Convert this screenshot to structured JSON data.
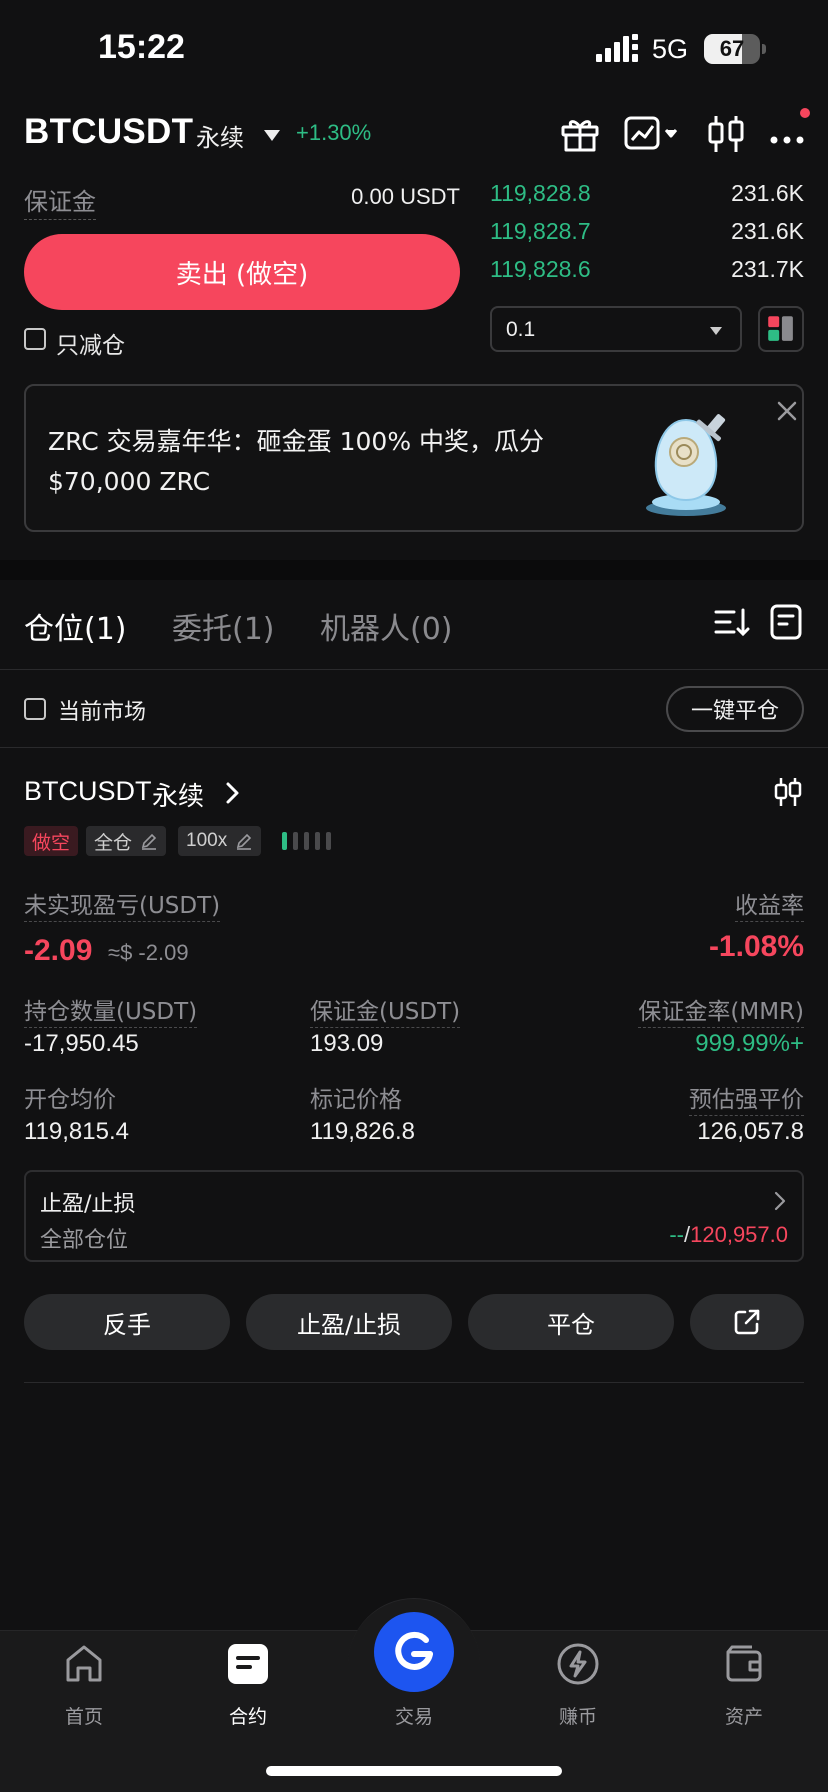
{
  "status_bar": {
    "time": "15:22",
    "network": "5G",
    "battery": "67",
    "battery_level": 0.67
  },
  "header": {
    "symbol": "BTCUSDT",
    "contract_type": "永续",
    "change": "+1.30%"
  },
  "trade_panel": {
    "margin_label": "保证金",
    "margin_value": "0.00 USDT",
    "sell_button": "卖出 (做空)",
    "reduce_only": "只减仓",
    "quantity": "0.1"
  },
  "order_book": [
    {
      "price": "119,828.8",
      "size": "231.6K"
    },
    {
      "price": "119,828.7",
      "size": "231.6K"
    },
    {
      "price": "119,828.6",
      "size": "231.7K"
    }
  ],
  "banner": {
    "text": "ZRC 交易嘉年华：砸金蛋 100% 中奖，瓜分 $70,000 ZRC"
  },
  "tabs": [
    {
      "label": "仓位(1)"
    },
    {
      "label": "委托(1)"
    },
    {
      "label": "机器人(0)"
    }
  ],
  "filter": {
    "current_market": "当前市场",
    "close_all": "一键平仓"
  },
  "position": {
    "symbol": "BTCUSDT",
    "type": "永续",
    "tags": {
      "side": "做空",
      "margin_mode": "全仓",
      "leverage": "100x"
    },
    "pnl_label": "未实现盈亏(USDT)",
    "pnl_value": "-2.09",
    "pnl_usd": "≈$ -2.09",
    "roe_label": "收益率",
    "roe_value": "-1.08%",
    "size_label": "持仓数量(USDT)",
    "size_value": "-17,950.45",
    "margin_label": "保证金(USDT)",
    "margin_value": "193.09",
    "mmr_label": "保证金率(MMR)",
    "mmr_value": "999.99%+",
    "entry_label": "开仓均价",
    "entry_value": "119,815.4",
    "mark_label": "标记价格",
    "mark_value": "119,826.8",
    "liq_label": "预估强平价",
    "liq_value": "126,057.8",
    "tpsl": {
      "title": "止盈/止损",
      "subtitle": "全部仓位",
      "tp": "--",
      "separator": "/",
      "sl": "120,957.0"
    }
  },
  "actions": {
    "reverse": "反手",
    "tpsl": "止盈/止损",
    "close": "平仓"
  },
  "nav": {
    "home": "首页",
    "futures": "合约",
    "trade": "交易",
    "earn": "赚币",
    "assets": "资产"
  },
  "colors": {
    "up": "#2ebd85",
    "down": "#f6465d",
    "accent": "#1d55f0"
  }
}
